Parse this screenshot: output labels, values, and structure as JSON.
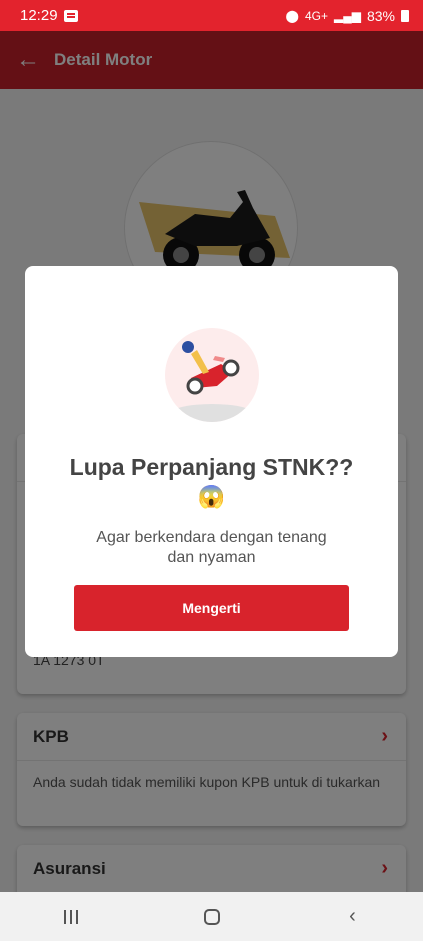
{
  "status_bar": {
    "time": "12:29",
    "network": "4G+",
    "battery": "83%"
  },
  "app_bar": {
    "title": "Detail Motor"
  },
  "detail_card": {
    "partial_text": "1A 1273 0T"
  },
  "kpb_card": {
    "title": "KPB",
    "body": "Anda sudah tidak memiliki kupon KPB untuk di tukarkan"
  },
  "asuransi_card": {
    "title": "Asuransi"
  },
  "dialog": {
    "title": "Lupa Perpanjang STNK??",
    "emoji": "😱",
    "message": "Agar berkendara dengan tenang dan nyaman",
    "button_label": "Mengerti"
  },
  "colors": {
    "brand_red": "#d8232c",
    "status_red": "#e3232d",
    "appbar_red": "#c8202a"
  },
  "icons": {
    "back": "arrow-left-icon",
    "chevron": "chevron-right-icon",
    "nav_recent": "recent-apps-icon",
    "nav_home": "home-icon",
    "nav_back": "back-icon"
  }
}
